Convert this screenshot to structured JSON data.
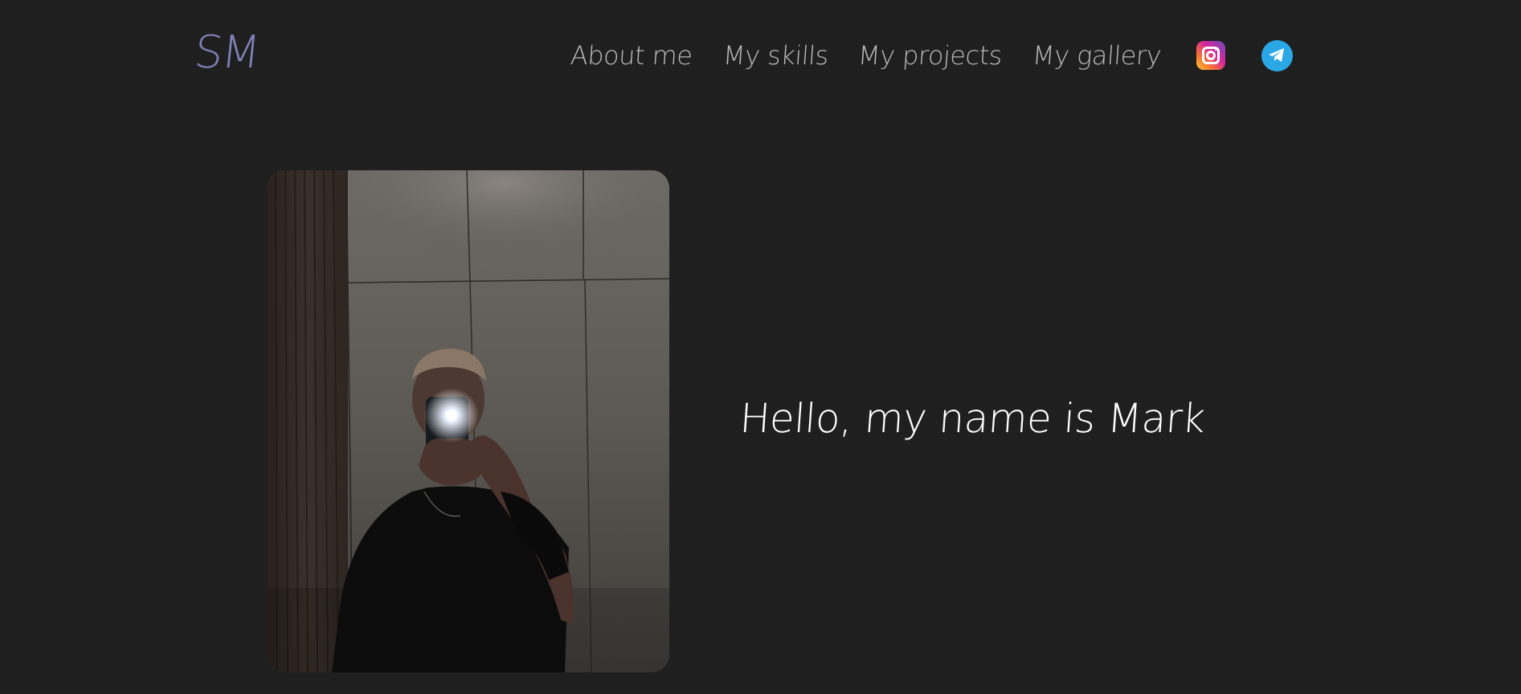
{
  "header": {
    "logo_text": "SM",
    "nav": [
      {
        "label": "About me"
      },
      {
        "label": "My skills"
      },
      {
        "label": "My projects"
      },
      {
        "label": "My gallery"
      }
    ],
    "social": [
      {
        "icon": "instagram-icon"
      },
      {
        "icon": "telegram-icon"
      }
    ]
  },
  "hero": {
    "photo_icon": "profile-photo",
    "greeting": "Hello, my name is Mark"
  },
  "colors": {
    "background": "#1f1f1f",
    "logo": "#7f7fb6",
    "nav_text": "#b8b8b8",
    "greeting_text": "#ffffff",
    "telegram": "#2aa8e6"
  }
}
